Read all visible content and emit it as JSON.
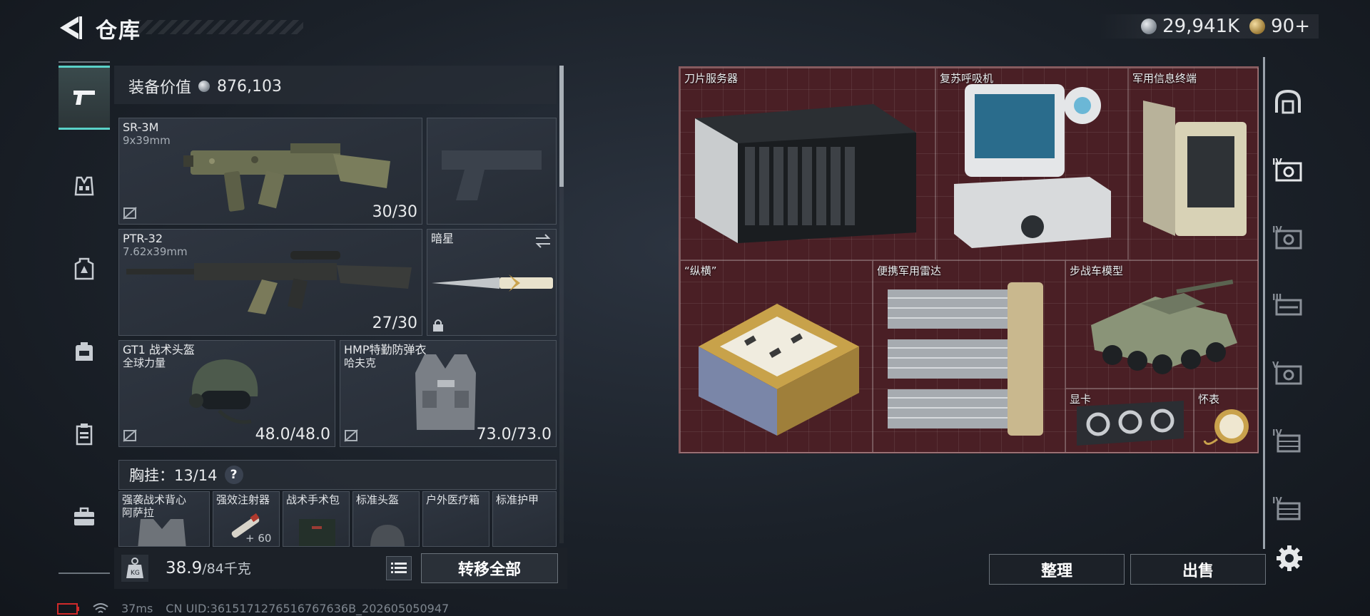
{
  "header": {
    "title": "仓库",
    "currency_silver": "29,941K",
    "currency_gold": "90+"
  },
  "left_nav": {
    "items": [
      "weapons-icon",
      "vest-icon",
      "armor-icon",
      "backpack-icon",
      "container-icon",
      "toolbox-icon"
    ]
  },
  "loadout": {
    "value_label": "装备价值",
    "value": "876,103",
    "primary_weapon": {
      "name": "SR-3M",
      "caliber": "9x39mm",
      "ammo": "30/30"
    },
    "secondary_weapon": {
      "name": "PTR-32",
      "caliber": "7.62x39mm",
      "ammo": "27/30"
    },
    "melee": {
      "name": "暗星"
    },
    "helmet": {
      "name": "GT1 战术头盔",
      "brand": "全球力量",
      "durability": "48.0/48.0"
    },
    "armor": {
      "name": "HMP特勤防弹衣",
      "brand": "哈夫克",
      "durability": "73.0/73.0"
    },
    "chest_rig": {
      "label": "胸挂：13/14",
      "help": "?"
    },
    "rig_items": [
      {
        "name": "强袭战术背心",
        "sub": "阿萨拉"
      },
      {
        "name": "强效注射器",
        "sub": ""
      },
      {
        "name": "战术手术包",
        "sub": ""
      },
      {
        "name": "标准头盔",
        "sub": ""
      },
      {
        "name": "户外医疗箱",
        "sub": ""
      },
      {
        "name": "标准护甲",
        "sub": ""
      }
    ],
    "injector_count": "+ 60",
    "weight": "38.9",
    "weight_cap": "/84千克",
    "transfer_all": "转移全部"
  },
  "storage": {
    "items": [
      {
        "name": "刀片服务器"
      },
      {
        "name": "复苏呼吸机"
      },
      {
        "name": "军用信息终端"
      },
      {
        "name": "“纵横”"
      },
      {
        "name": "便携军用雷达"
      },
      {
        "name": "步战车模型"
      },
      {
        "name": "显卡"
      },
      {
        "name": "怀表"
      }
    ],
    "sort_label": "整理",
    "sell_label": "出售",
    "bg_color": "#4a1f25"
  },
  "right_rail": {
    "items": [
      "helmet-slot-icon",
      "armor-level-iv-icon",
      "armor-level-iv-alt-icon",
      "armor-level-iii-icon",
      "armor-level-v-icon",
      "vest-level-iv-icon",
      "vest-level-iv-alt-icon"
    ],
    "levels": [
      "",
      "IV",
      "IV",
      "III",
      "V",
      "IV",
      "IV"
    ]
  },
  "footer": {
    "ping": "37ms",
    "uid": "CN UID:3615171276516767636B_202605050947"
  }
}
